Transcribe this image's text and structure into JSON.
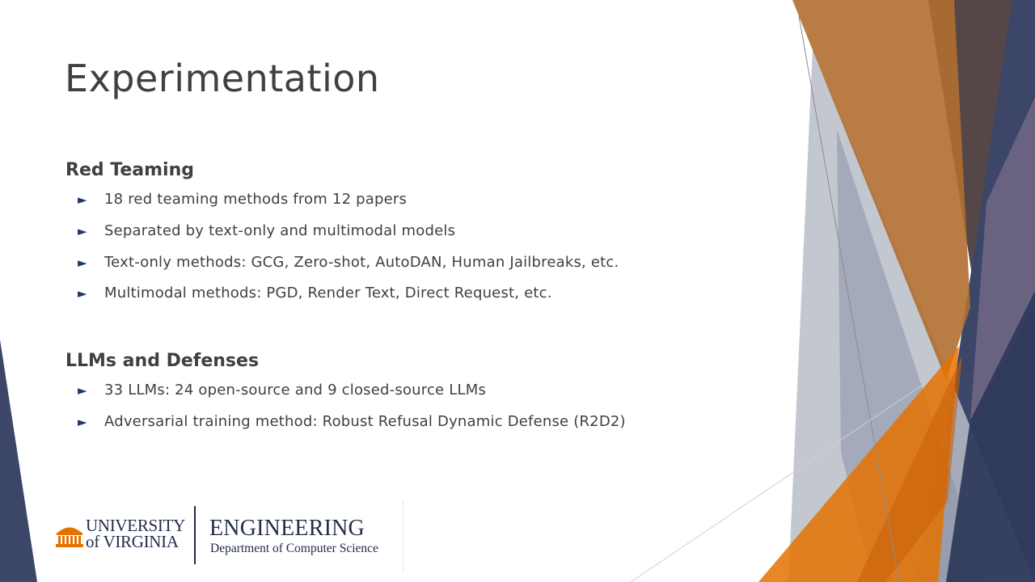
{
  "slide": {
    "title": "Experimentation",
    "sections": [
      {
        "heading": "Red Teaming",
        "bullets": [
          "18 red teaming methods from 12 papers",
          "Separated by text-only and multimodal models",
          "Text-only methods: GCG, Zero-shot, AutoDAN, Human Jailbreaks, etc.",
          "Multimodal methods: PGD, Render Text, Direct Request, etc."
        ]
      },
      {
        "heading": "LLMs and Defenses",
        "bullets": [
          "33 LLMs: 24 open-source and 9 closed-source LLMs",
          "Adversarial training method: Robust Refusal Dynamic Defense (R2D2)"
        ]
      }
    ],
    "bullet_marker": "►"
  },
  "footer": {
    "university_line1": "UNIVERSITY",
    "university_line2": "of VIRGINIA",
    "school": "ENGINEERING",
    "department": "Department of Computer Science"
  },
  "colors": {
    "navy": "#232d4b",
    "orange": "#e57200",
    "text": "#404040"
  },
  "icons": {
    "bullet": "triangle-right-icon",
    "logo": "rotunda-icon"
  }
}
